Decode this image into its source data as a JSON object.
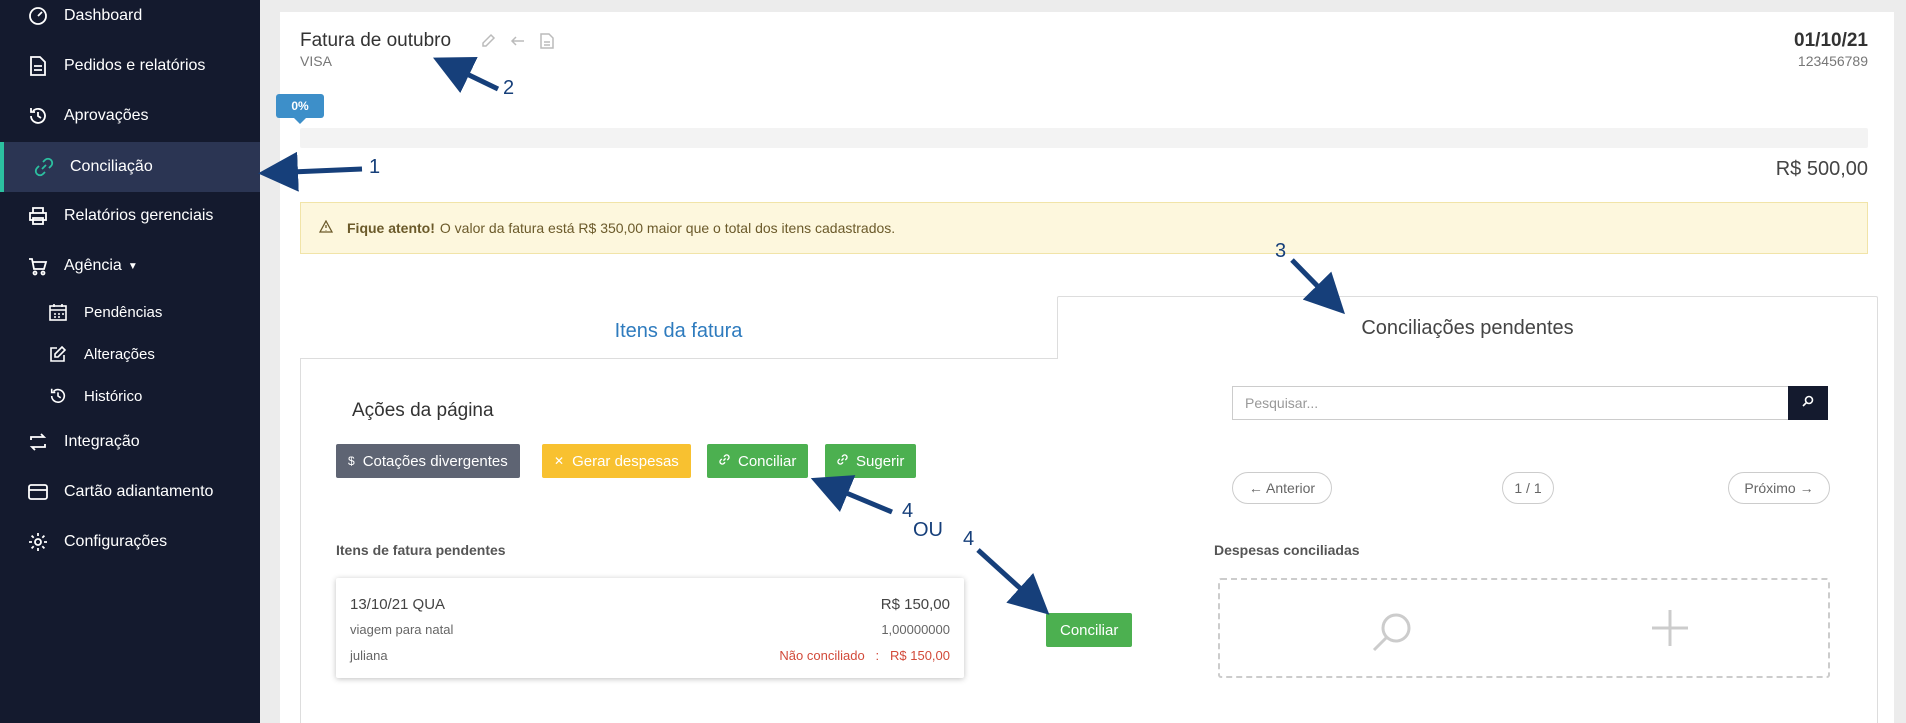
{
  "sidebar": {
    "items": [
      {
        "label": "Dashboard"
      },
      {
        "label": "Pedidos e relatórios"
      },
      {
        "label": "Aprovações"
      },
      {
        "label": "Conciliação"
      },
      {
        "label": "Relatórios gerenciais"
      },
      {
        "label": "Agência"
      },
      {
        "label": "Pendências"
      },
      {
        "label": "Alterações"
      },
      {
        "label": "Histórico"
      },
      {
        "label": "Integração"
      },
      {
        "label": "Cartão adiantamento"
      },
      {
        "label": "Configurações"
      }
    ]
  },
  "header": {
    "title": "Fatura de outubro",
    "subtitle": "VISA",
    "date": "01/10/21",
    "doc_number": "123456789"
  },
  "progress": {
    "label": "0%",
    "value": 0
  },
  "total": "R$ 500,00",
  "alert": {
    "strong": "Fique atento!",
    "message": "O valor da fatura está R$ 350,00 maior que o total dos itens cadastrados."
  },
  "tabs": {
    "items": "Itens da fatura",
    "pending": "Conciliações pendentes"
  },
  "actions": {
    "title": "Ações da página",
    "cotacoes": "Cotações divergentes",
    "gerar": "Gerar despesas",
    "conciliar": "Conciliar",
    "sugerir": "Sugerir"
  },
  "search": {
    "placeholder": "Pesquisar..."
  },
  "pagination": {
    "prev": "← Anterior",
    "page": "1 / 1",
    "next": "Próximo →"
  },
  "pending_items": {
    "title": "Itens de fatura pendentes",
    "items": [
      {
        "date": "13/10/21 QUA",
        "amount": "R$ 150,00",
        "description": "viagem para natal",
        "rate": "1,00000000",
        "user": "juliana",
        "status": "Não conciliado",
        "status_sep": ":",
        "status_amount": "R$ 150,00"
      }
    ]
  },
  "conciliar_item_button": "Conciliar",
  "reconciled": {
    "title": "Despesas conciliadas"
  },
  "annotations": {
    "a1": "1",
    "a2": "2",
    "a3": "3",
    "a4a": "4",
    "ou": "OU",
    "a4b": "4"
  },
  "colors": {
    "sidebar": "#141a2e",
    "accent": "#2cc0a0",
    "primary": "#3d8fc9",
    "success": "#4cb050",
    "warning": "#f8c130",
    "danger": "#d24a3a"
  }
}
